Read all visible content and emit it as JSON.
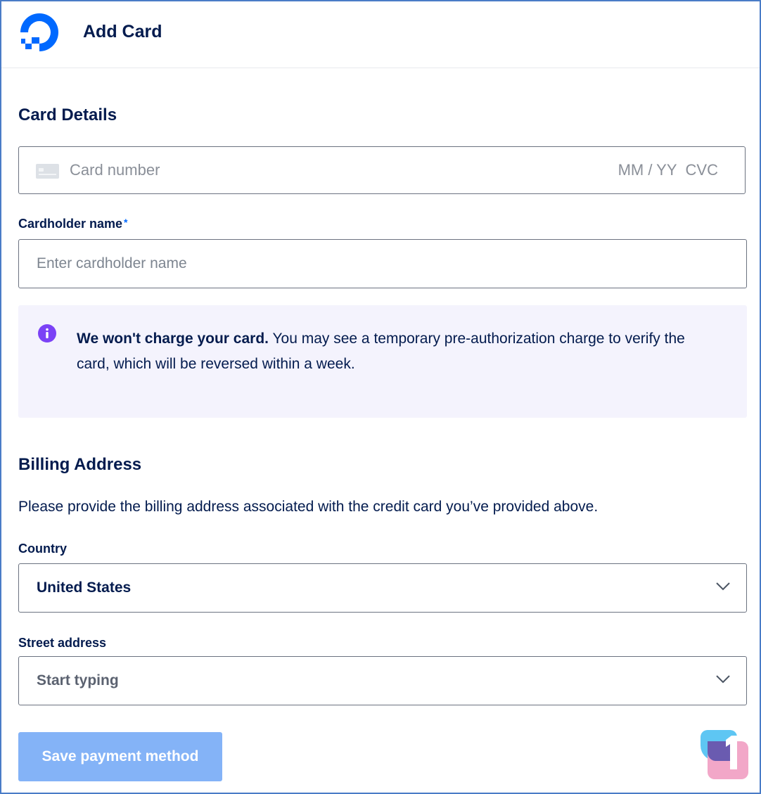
{
  "header": {
    "title": "Add Card",
    "logo_icon": "digitalocean-logo-icon",
    "brand_color": "#0069ff"
  },
  "card_details": {
    "section_title": "Card Details",
    "card_number_placeholder": "Card number",
    "expiry_placeholder": "MM / YY",
    "cvc_placeholder": "CVC",
    "card_icon": "credit-card-icon"
  },
  "cardholder": {
    "label": "Cardholder name",
    "required_mark": "*",
    "placeholder": "Enter cardholder name",
    "value": ""
  },
  "notice": {
    "icon": "info-icon",
    "bold_text": "We won't charge your card.",
    "text": " You may see a temporary pre-authorization charge to verify the card, which will be reversed within a week.",
    "icon_color": "#7b42f6",
    "background": "#f4f3fd"
  },
  "billing": {
    "section_title": "Billing Address",
    "description": "Please provide the billing address associated with the credit card you’ve provided above.",
    "country_label": "Country",
    "country_value": "United States",
    "street_label": "Street address",
    "street_placeholder": "Start typing"
  },
  "actions": {
    "save_label": "Save payment method",
    "save_color": "#84b3f7"
  }
}
